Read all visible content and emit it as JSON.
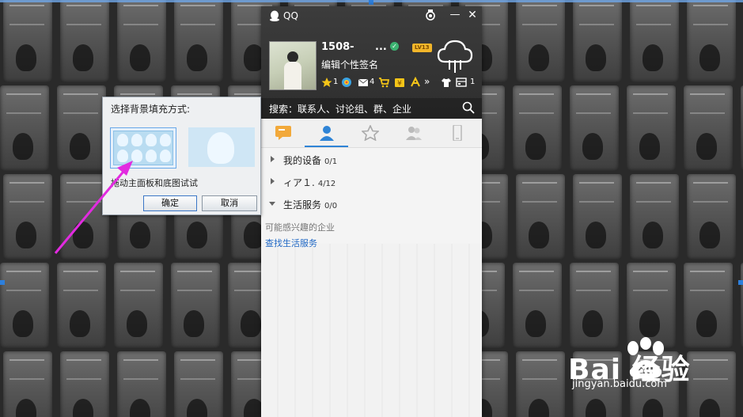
{
  "window": {
    "title": "QQ",
    "accent": "#2f84d6"
  },
  "profile": {
    "nickname": "1508-",
    "nickname_ellipsis": "...",
    "level": "LV13",
    "signature": "编辑个性签名",
    "status_icons": [
      {
        "icon": "star-icon",
        "count": "1"
      },
      {
        "icon": "qzone-icon",
        "count": ""
      },
      {
        "icon": "mail-icon",
        "count": "4"
      },
      {
        "icon": "cart-icon",
        "count": ""
      },
      {
        "icon": "wallet-icon",
        "count": ""
      },
      {
        "icon": "game-icon",
        "count": ""
      },
      {
        "icon": "more-icon",
        "count": "»"
      },
      {
        "icon": "shirt-icon",
        "count": ""
      },
      {
        "icon": "app-box-icon",
        "count": "1"
      }
    ]
  },
  "search": {
    "placeholder": "搜索：联系人、讨论组、群、企业"
  },
  "tabs": [
    {
      "name": "tab-messages",
      "icon": "chat-bubble-icon"
    },
    {
      "name": "tab-contacts",
      "icon": "person-icon"
    },
    {
      "name": "tab-favorites",
      "icon": "star-icon"
    },
    {
      "name": "tab-groups",
      "icon": "group-icon"
    },
    {
      "name": "tab-mobile",
      "icon": "phone-icon"
    }
  ],
  "groups": [
    {
      "name": "我的设备",
      "count": "0/1",
      "open": false
    },
    {
      "name": "ィア１.",
      "count": "4/12",
      "open": false
    },
    {
      "name": "生活服务",
      "count": "0/0",
      "open": true
    }
  ],
  "life_service": {
    "label": "可能感兴趣的企业",
    "link": "查找生活服务"
  },
  "dialog": {
    "title": "选择背景填充方式:",
    "hint": "拖动主面板和底图试试",
    "ok_label": "确定",
    "cancel_label": "取消"
  },
  "watermark": {
    "brand": "Bai  经验",
    "url": "jingyan.baidu.com"
  }
}
